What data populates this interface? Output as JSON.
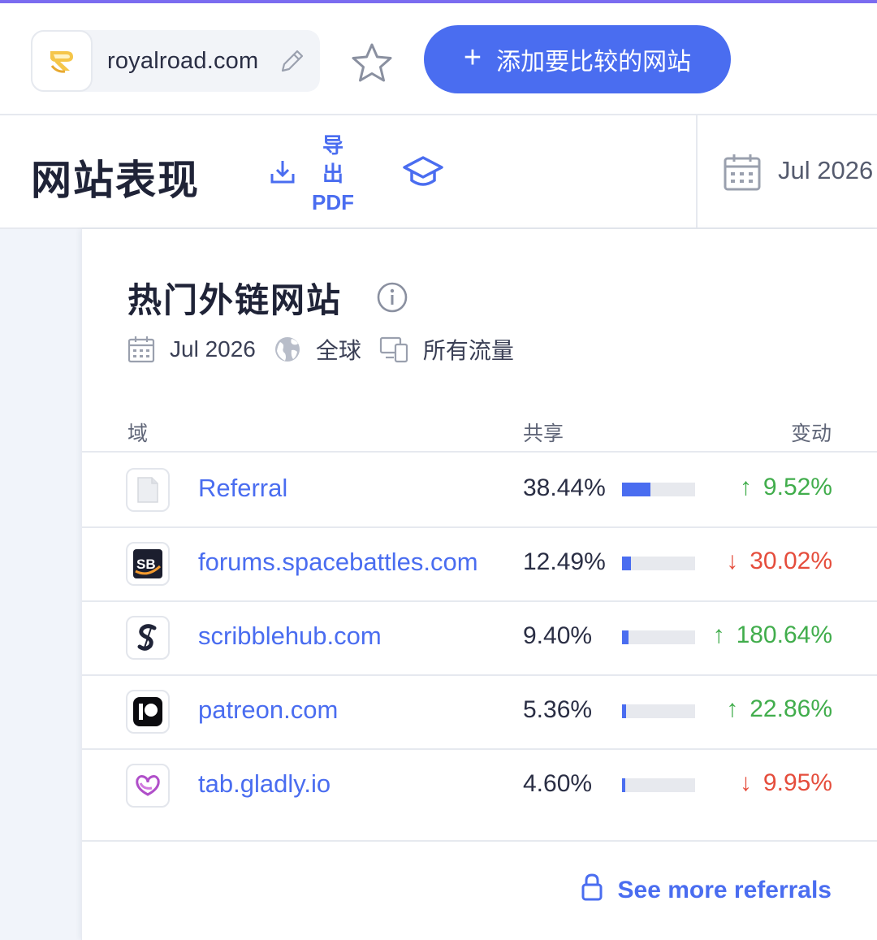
{
  "header": {
    "site_name": "royalroad.com",
    "add_compare_label": "添加要比较的网站",
    "add_compare_plus": "+"
  },
  "title_bar": {
    "page_title": "网站表现",
    "export_lines": [
      "导",
      "出",
      "PDF"
    ],
    "date": "Jul 2026"
  },
  "card": {
    "title": "热门外链网站",
    "meta": {
      "date": "Jul 2026",
      "region": "全球",
      "traffic": "所有流量"
    },
    "columns": {
      "domain": "域",
      "share": "共享",
      "change": "变动"
    },
    "rows": [
      {
        "domain": "Referral",
        "share": "38.44%",
        "share_value": 38.44,
        "change": "9.52%",
        "direction": "up",
        "icon": "generic-page-icon"
      },
      {
        "domain": "forums.spacebattles.com",
        "share": "12.49%",
        "share_value": 12.49,
        "change": "30.02%",
        "direction": "down",
        "icon": "spacebattles-logo-icon"
      },
      {
        "domain": "scribblehub.com",
        "share": "9.40%",
        "share_value": 9.4,
        "change": "180.64%",
        "direction": "up",
        "icon": "scribblehub-logo-icon"
      },
      {
        "domain": "patreon.com",
        "share": "5.36%",
        "share_value": 5.36,
        "change": "22.86%",
        "direction": "up",
        "icon": "patreon-logo-icon"
      },
      {
        "domain": "tab.gladly.io",
        "share": "4.60%",
        "share_value": 4.6,
        "change": "9.95%",
        "direction": "down",
        "icon": "gladly-logo-icon"
      }
    ],
    "see_more_label": "See more referrals"
  },
  "colors": {
    "accent": "#4a6df0",
    "up": "#41ad4c",
    "down": "#e54d3c",
    "top_accent": "#7b6cf0"
  },
  "icons": [
    "royalroad-favicon",
    "edit-icon",
    "star-icon",
    "download-icon",
    "graduation-cap-icon",
    "calendar-icon",
    "info-icon",
    "globe-icon",
    "devices-icon",
    "lock-icon",
    "arrow-up-icon",
    "arrow-down-icon"
  ]
}
